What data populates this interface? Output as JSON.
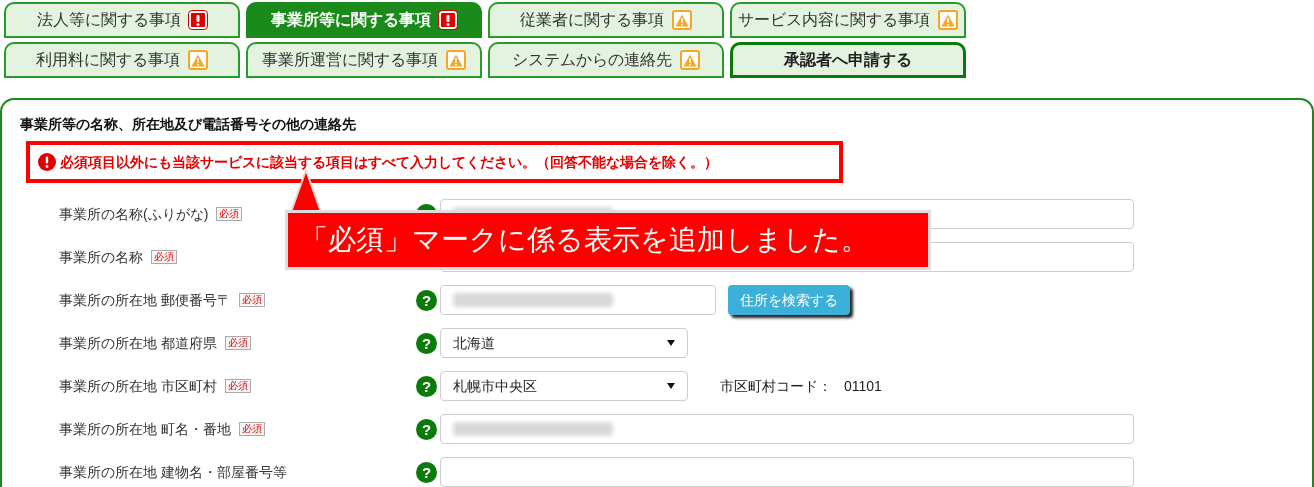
{
  "tabs": [
    {
      "label": "法人等に関する事項",
      "selected": false,
      "kind": "error"
    },
    {
      "label": "事業所等に関する事項",
      "selected": true,
      "kind": "error"
    },
    {
      "label": "従業者に関する事項",
      "selected": false,
      "kind": "warning"
    },
    {
      "label": "サービス内容に関する事項",
      "selected": false,
      "kind": "warning"
    },
    {
      "label": "利用料に関する事項",
      "selected": false,
      "kind": "warning"
    },
    {
      "label": "事業所運営に関する事項",
      "selected": false,
      "kind": "warning"
    },
    {
      "label": "システムからの連絡先",
      "selected": false,
      "kind": "warning"
    },
    {
      "label": "承認者へ申請する",
      "selected": false,
      "kind": "submit"
    }
  ],
  "section": {
    "title": "事業所等の名称、所在地及び電話番号その他の連絡先",
    "notice": "必須項目以外にも当該サービスに該当する項目はすべて入力してください。（回答不能な場合を除く。）",
    "rows": [
      {
        "label": "事業所の名称(ふりがな)",
        "badge": "必須",
        "kind": "text",
        "masked": true
      },
      {
        "label": "事業所の名称",
        "badge": "必須",
        "kind": "text"
      },
      {
        "label": "事業所の所在地 郵便番号〒",
        "badge": "必須",
        "help": "?",
        "kind": "postal",
        "masked": true,
        "button": "住所を検索する"
      },
      {
        "label": "事業所の所在地 都道府県",
        "badge": "必須",
        "help": "?",
        "kind": "select",
        "value": "北海道"
      },
      {
        "label": "事業所の所在地 市区町村",
        "badge": "必須",
        "help": "?",
        "kind": "select",
        "value": "札幌市中央区",
        "extra_label": "市区町村コード：",
        "extra_value": "01101"
      },
      {
        "label": "事業所の所在地 町名・番地",
        "badge": "必須",
        "help": "?",
        "kind": "text",
        "masked": true
      },
      {
        "label": "事業所の所在地 建物名・部屋番号等",
        "help": "?",
        "kind": "text",
        "masked": false
      }
    ]
  },
  "callout": {
    "text": "「必須」マークに係る表示を追加しました。"
  }
}
